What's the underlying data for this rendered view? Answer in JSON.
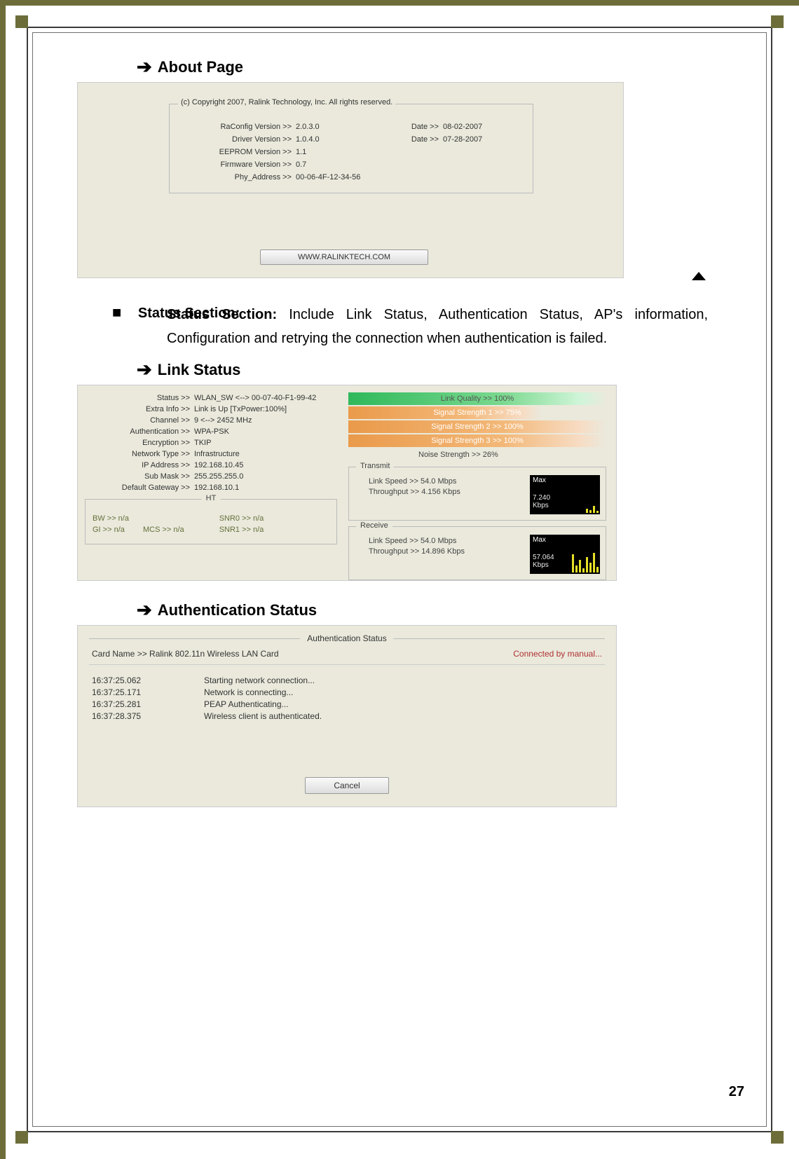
{
  "headings": {
    "about": "About Page",
    "link": "Link Status",
    "auth": "Authentication Status"
  },
  "about": {
    "copyright": "(c) Copyright 2007, Ralink Technology, Inc. All rights reserved.",
    "rows": {
      "raconfig_k": "RaConfig Version >>",
      "raconfig_v": "2.0.3.0",
      "raconfig_dk": "Date >>",
      "raconfig_dv": "08-02-2007",
      "driver_k": "Driver Version >>",
      "driver_v": "1.0.4.0",
      "driver_dk": "Date >>",
      "driver_dv": "07-28-2007",
      "eeprom_k": "EEPROM Version >>",
      "eeprom_v": "1.1",
      "firmware_k": "Firmware Version >>",
      "firmware_v": "0.7",
      "phy_k": "Phy_Address >>",
      "phy_v": "00-06-4F-12-34-56"
    },
    "url_btn": "WWW.RALINKTECH.COM"
  },
  "status_para": {
    "label": "Status Section:",
    "body": "Include Link Status, Authentication Status, AP's information, Configuration and retrying the connection when authentication is failed."
  },
  "link_status": {
    "left": {
      "status_k": "Status >>",
      "status_v": "WLAN_SW <--> 00-07-40-F1-99-42",
      "extra_k": "Extra Info >>",
      "extra_v": "Link is Up [TxPower:100%]",
      "channel_k": "Channel >>",
      "channel_v": "9 <--> 2452 MHz",
      "auth_k": "Authentication >>",
      "auth_v": "WPA-PSK",
      "enc_k": "Encryption >>",
      "enc_v": "TKIP",
      "ntype_k": "Network Type >>",
      "ntype_v": "Infrastructure",
      "ip_k": "IP Address >>",
      "ip_v": "192.168.10.45",
      "mask_k": "Sub Mask >>",
      "mask_v": "255.255.255.0",
      "gw_k": "Default Gateway >>",
      "gw_v": "192.168.10.1"
    },
    "ht": {
      "label": "HT",
      "bw": "BW >> n/a",
      "gi": "GI >> n/a",
      "mcs": "MCS >> n/a",
      "snr0": "SNR0 >> n/a",
      "snr1": "SNR1 >> n/a"
    },
    "bars": {
      "lq": "Link Quality >> 100%",
      "s1": "Signal Strength 1 >> 75%",
      "s2": "Signal Strength 2 >> 100%",
      "s3": "Signal Strength 3 >> 100%",
      "noise": "Noise Strength >> 26%"
    },
    "transmit": {
      "label": "Transmit",
      "speed": "Link Speed >> 54.0 Mbps",
      "tp": "Throughput >> 4.156 Kbps",
      "max": "Max",
      "val": "7.240",
      "unit": "Kbps"
    },
    "receive": {
      "label": "Receive",
      "speed": "Link Speed >> 54.0 Mbps",
      "tp": "Throughput >> 14.896 Kbps",
      "max": "Max",
      "val": "57.064",
      "unit": "Kbps"
    }
  },
  "auth": {
    "title": "Authentication Status",
    "card_k": "Card Name >>",
    "card_v": "Ralink 802.11n Wireless LAN Card",
    "conn": "Connected by manual...",
    "log": [
      {
        "t": "16:37:25.062",
        "m": "Starting network connection..."
      },
      {
        "t": "16:37:25.171",
        "m": "Network is connecting..."
      },
      {
        "t": "16:37:25.281",
        "m": "PEAP Authenticating..."
      },
      {
        "t": "16:37:28.375",
        "m": "Wireless client is authenticated."
      }
    ],
    "cancel": "Cancel"
  },
  "page_number": "27"
}
